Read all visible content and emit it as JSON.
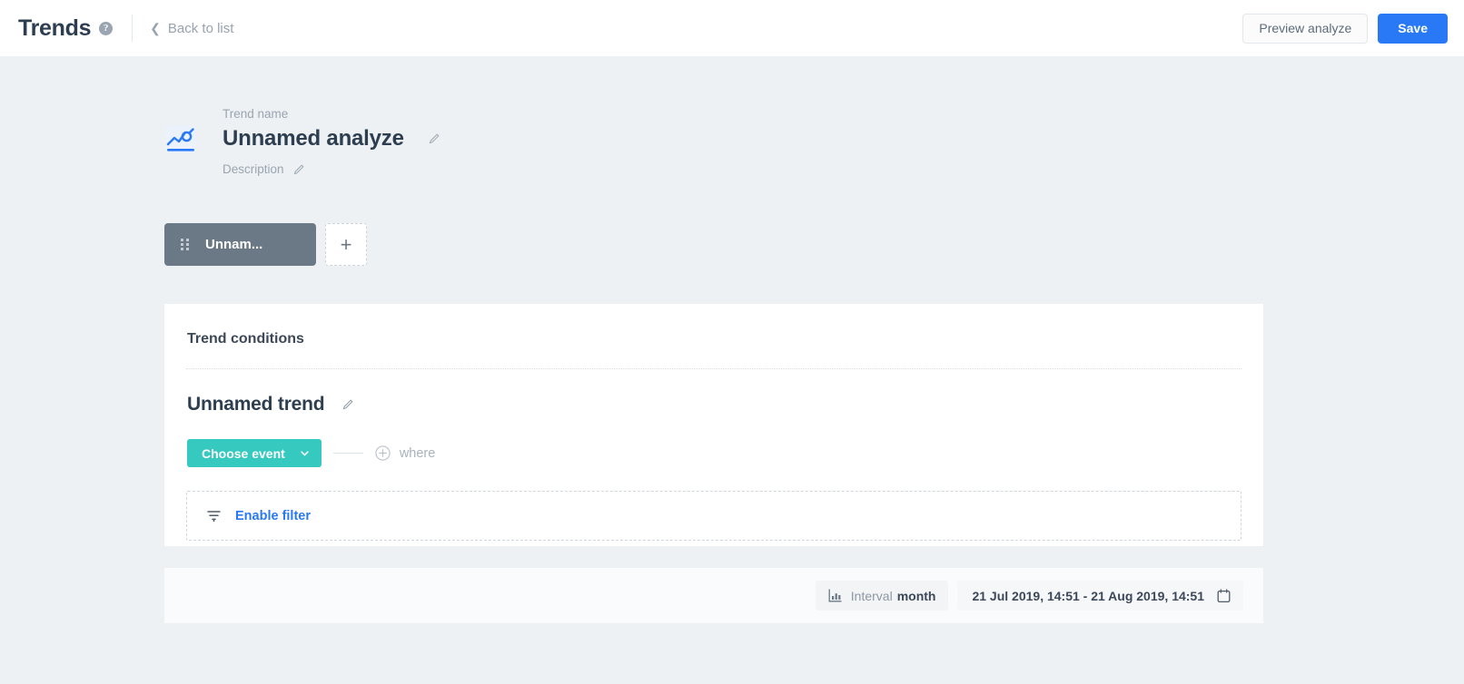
{
  "header": {
    "app_title": "Trends",
    "help_icon": "question-mark-circle-icon",
    "back_link": "Back to list",
    "back_chevron": "chevron-left-icon",
    "preview_button": "Preview analyze",
    "save_button": "Save"
  },
  "trend_meta": {
    "icon": "trend-analyze-icon",
    "name_label": "Trend name",
    "name_value": "Unnamed analyze",
    "name_edit_icon": "pencil-icon",
    "description_label": "Description",
    "description_edit_icon": "pencil-icon"
  },
  "tabs": {
    "items": [
      {
        "label": "Unnam...",
        "handle_icon": "drag-handle-icon",
        "active": true
      }
    ],
    "add_icon": "plus-icon"
  },
  "conditions_card": {
    "title": "Trend conditions",
    "trend_title": "Unnamed trend",
    "trend_edit_icon": "pencil-icon",
    "choose_event_label": "Choose event",
    "choose_event_caret": "chevron-down-icon",
    "add_condition_icon": "plus-circle-icon",
    "where_label": "where",
    "filter_icon": "funnel-icon",
    "enable_filter_label": "Enable filter"
  },
  "bottom_bar": {
    "interval_icon": "bar-chart-icon",
    "interval_label": "Interval",
    "interval_value": "month",
    "date_range": "21 Jul 2019, 14:51 - 21 Aug 2019, 14:51",
    "calendar_icon": "calendar-icon"
  },
  "colors": {
    "brand_blue": "#2979f7",
    "teal": "#35c9c0",
    "tab_gray": "#6b7886",
    "page_bg": "#eef1f3"
  }
}
